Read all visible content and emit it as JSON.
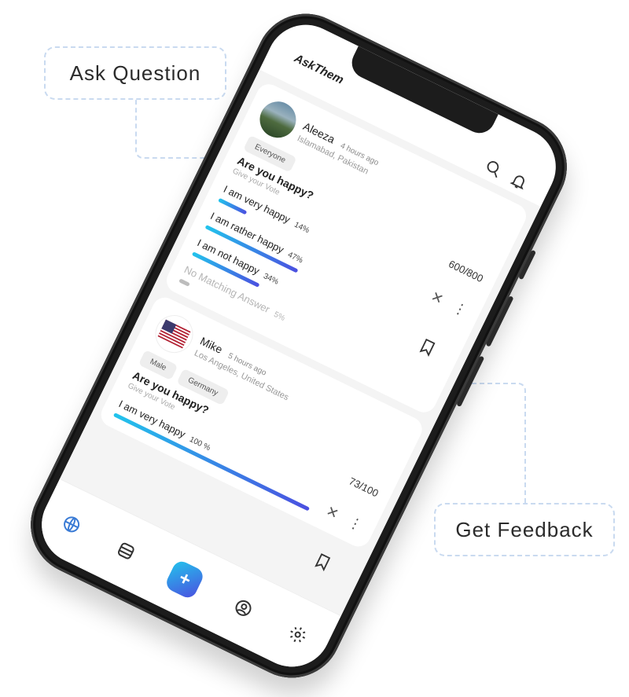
{
  "callouts": {
    "ask": "Ask Question",
    "feedback": "Get Feedback"
  },
  "app": {
    "title": "AskThem"
  },
  "icons": {
    "search": "search-icon",
    "notifications": "bell-icon",
    "close": "close-icon",
    "more": "more-vertical-icon",
    "bookmark": "bookmark-icon"
  },
  "colors": {
    "bar_start": "#22c4ec",
    "bar_end": "#4b4fe0",
    "muted_bar": "#bdbdbd"
  },
  "posts": [
    {
      "user": "Aleeza",
      "time": "4 hours ago",
      "location": "Islamabad, Pakistan",
      "tags": [
        "Everyone"
      ],
      "question": "Are you happy?",
      "hint": "Give your Vote",
      "count": "600/800",
      "options": [
        {
          "label": "I am very happy",
          "pct": "14%",
          "value": 14
        },
        {
          "label": "I am rather happy",
          "pct": "47%",
          "value": 47
        },
        {
          "label": "I am not happy",
          "pct": "34%",
          "value": 34
        },
        {
          "label": "No Matching Answer",
          "pct": "5%",
          "value": 5,
          "muted": true
        }
      ]
    },
    {
      "user": "Mike",
      "time": "5 hours ago",
      "location": "Los Angeles, United States",
      "tags": [
        "Male",
        "Germany"
      ],
      "question": "Are you happy?",
      "hint": "Give your Vote",
      "count": "73/100",
      "options": [
        {
          "label": "I am very happy",
          "pct": "100 %",
          "value": 100
        }
      ]
    }
  ],
  "nav": [
    "globe-icon",
    "database-icon",
    "add-icon",
    "profile-icon",
    "settings-icon"
  ]
}
